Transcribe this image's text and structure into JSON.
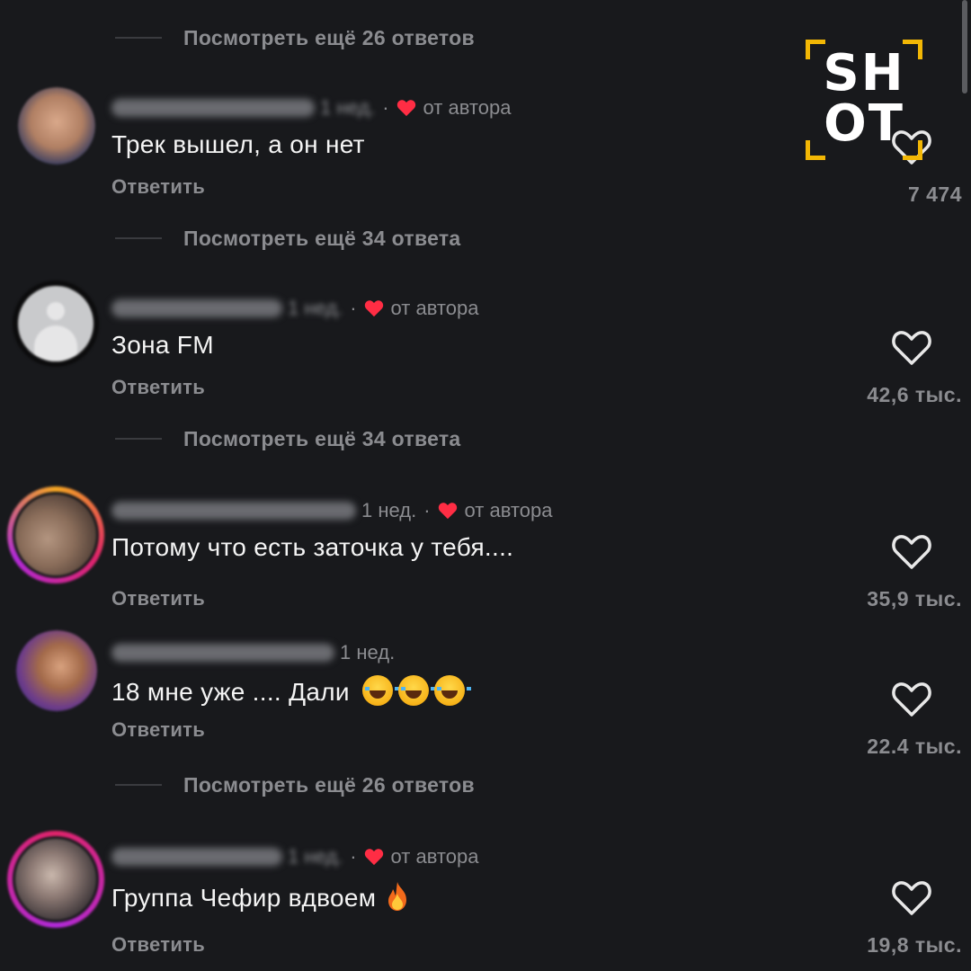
{
  "brand": {
    "logo_line1": "SH",
    "logo_line2": "OT",
    "accent": "#f2b705"
  },
  "colors": {
    "background": "#18191c",
    "secondary_text": "#8b8c90",
    "heart_red": "#ff2d44"
  },
  "view_more": [
    {
      "label": "Посмотреть ещё 26 ответов"
    },
    {
      "label": "Посмотреть ещё 34 ответа"
    },
    {
      "label": "Посмотреть ещё 34 ответа"
    },
    {
      "label": "Посмотреть ещё 26 ответов"
    }
  ],
  "comments": [
    {
      "date": "1 нед.",
      "author_badge": "от автора",
      "text": "Трек вышел, а он нет",
      "reply": "Ответить",
      "likes": "7 474"
    },
    {
      "date": "1 нед.",
      "author_badge": "от автора",
      "text": "Зона FM",
      "reply": "Ответить",
      "likes": "42,6 тыс."
    },
    {
      "date": "1 нед.",
      "author_badge": "от автора",
      "text": "Потому что есть заточка у тебя....",
      "reply": "Ответить",
      "likes": "35,9 тыс."
    },
    {
      "date": "1 нед.",
      "text": "18 мне уже .... Дали",
      "reply": "Ответить",
      "likes": "22.4 тыс."
    },
    {
      "date": "1 нед.",
      "author_badge": "от автора",
      "text": "Группа Чефир вдвоем",
      "reply": "Ответить",
      "likes": "19,8 тыс."
    }
  ]
}
